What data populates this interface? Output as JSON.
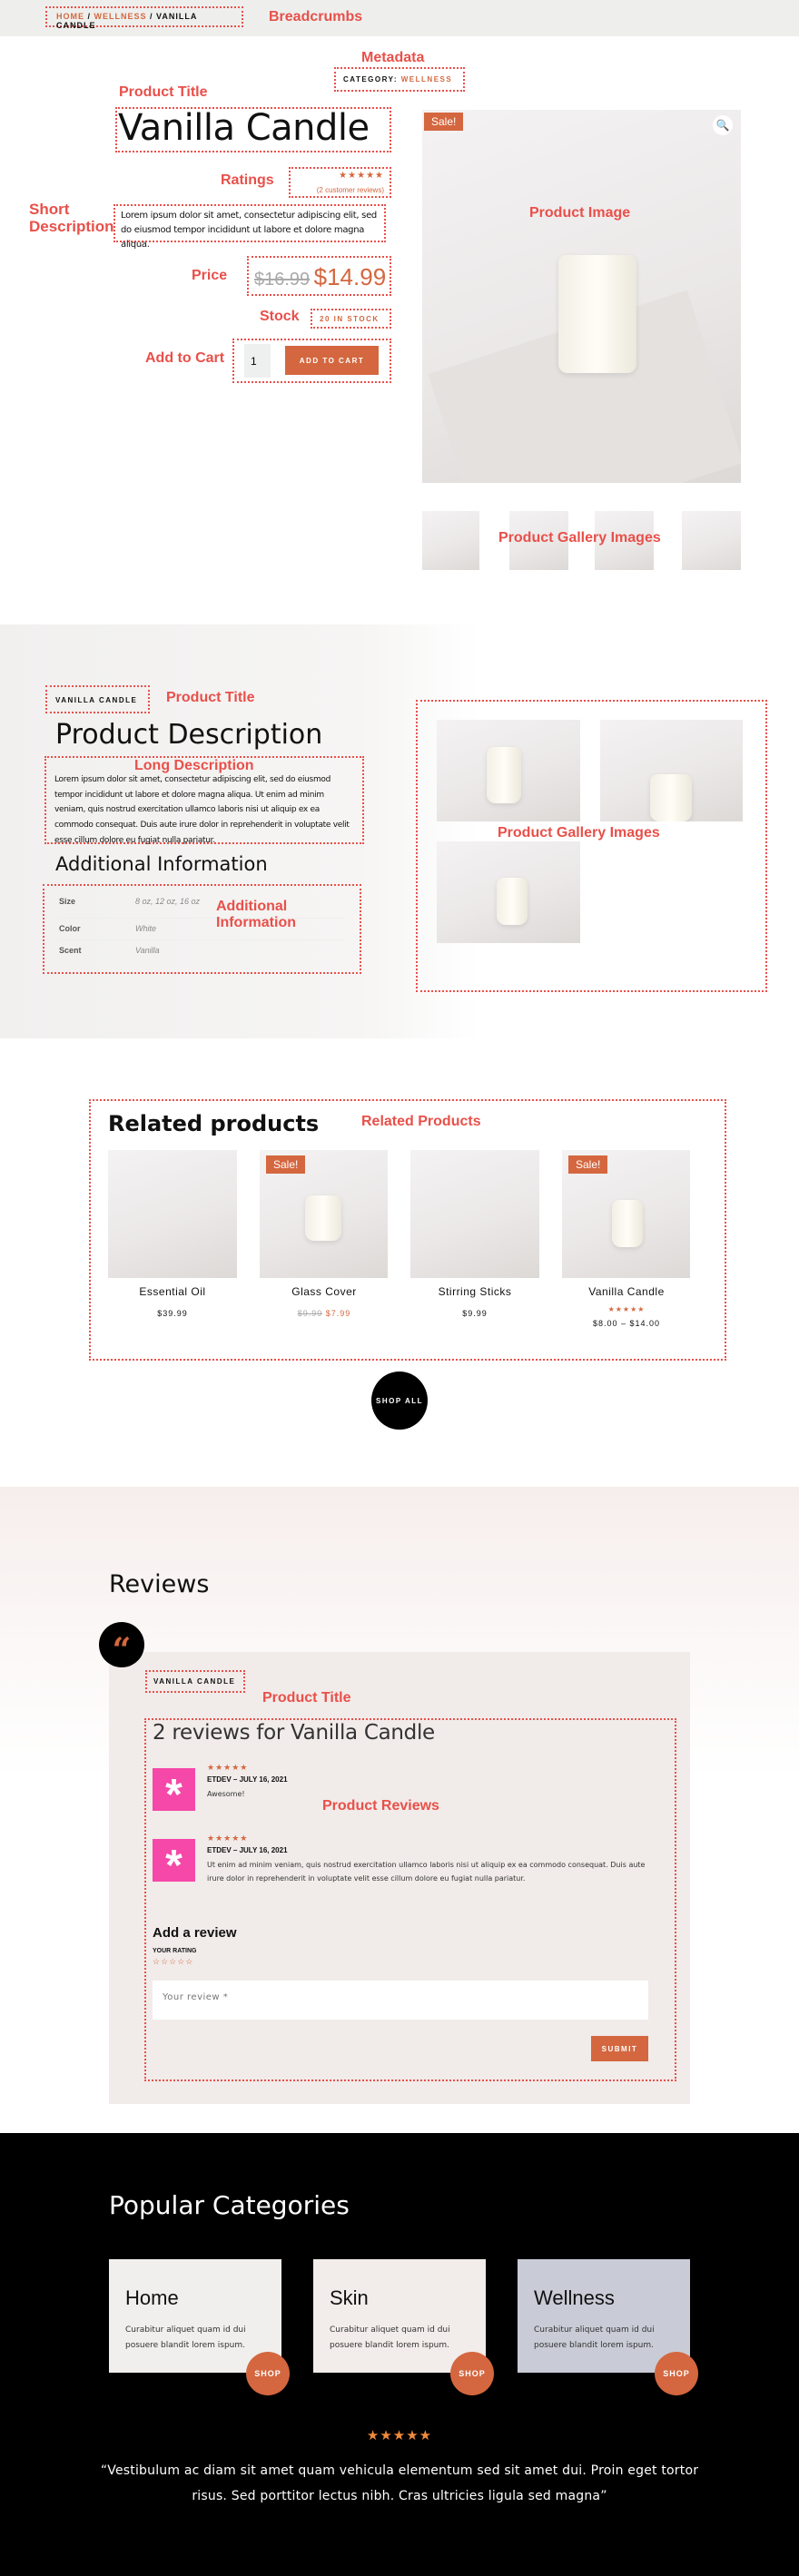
{
  "breadcrumbs": {
    "home": "Home",
    "sep1": " / ",
    "wellness": "Wellness",
    "sep2": " / ",
    "current": "Vanilla Candle"
  },
  "metadata": {
    "label": "Category:",
    "value": "Wellness"
  },
  "product": {
    "title": "Vanilla Candle",
    "stars": "★★★★★",
    "reviews_link": "(2 customer reviews)",
    "short_description": "Lorem ipsum dolor sit amet, consectetur adipiscing elit, sed do eiusmod tempor incididunt ut labore et dolore magna aliqua.",
    "old_price": "$16.99",
    "price": "$14.99",
    "stock": "20 in stock",
    "quantity": "1",
    "add_to_cart": "Add to cart",
    "sale_badge": "Sale!",
    "rating": 5
  },
  "description": {
    "title_tag": "Vanilla Candle",
    "heading": "Product Description",
    "text": "Lorem ipsum dolor sit amet, consectetur adipiscing elit, sed do eiusmod tempor incididunt ut labore et dolore magna aliqua. Ut enim ad minim veniam, quis nostrud exercitation ullamco laboris nisi ut aliquip ex ea commodo consequat. Duis aute irure dolor in reprehenderit in voluptate velit esse cillum dolore eu fugiat nulla pariatur.",
    "additional_heading": "Additional Information",
    "attributes": [
      {
        "name": "Size",
        "value": "8 oz, 12 oz, 16 oz"
      },
      {
        "name": "Color",
        "value": "White"
      },
      {
        "name": "Scent",
        "value": "Vanilla"
      }
    ]
  },
  "related": {
    "heading": "Related products",
    "products": [
      {
        "name": "Essential Oil",
        "price": "$39.99",
        "old_price": "",
        "sale": ""
      },
      {
        "name": "Glass Cover",
        "price": "$7.99",
        "old_price": "$9.99",
        "sale": "Sale!"
      },
      {
        "name": "Stirring Sticks",
        "price": "$9.99",
        "old_price": "",
        "sale": ""
      },
      {
        "name": "Vanilla Candle",
        "price": "$8.00 – $14.00",
        "old_price": "",
        "sale": "Sale!",
        "stars": "★★★★★"
      }
    ],
    "shop_all": "Shop All"
  },
  "reviews": {
    "heading": "Reviews",
    "title_tag": "Vanilla Candle",
    "count_heading": "2 reviews for Vanilla Candle",
    "items": [
      {
        "stars": "★★★★★",
        "author": "ETDEV",
        "date": "July 16, 2021",
        "text": "Awesome!"
      },
      {
        "stars": "★★★★★",
        "author": "ETDEV",
        "date": "July 16, 2021",
        "text": "Ut enim ad minim veniam, quis nostrud exercitation ullamco laboris nisi ut aliquip ex ea commodo consequat. Duis aute irure dolor in reprehenderit in voluptate velit esse cillum dolore eu fugiat nulla pariatur."
      }
    ],
    "add_heading": "Add a review",
    "rating_label": "Your rating",
    "empty_stars": "☆☆☆☆☆",
    "review_placeholder": "Your review *",
    "submit": "Submit"
  },
  "categories": {
    "heading": "Popular Categories",
    "items": [
      {
        "name": "Home",
        "text": "Curabitur aliquet quam id dui posuere blandit lorem ispum.",
        "button": "Shop"
      },
      {
        "name": "Skin",
        "text": "Curabitur aliquet quam id dui posuere blandit lorem ispum.",
        "button": "Shop"
      },
      {
        "name": "Wellness",
        "text": "Curabitur aliquet quam id dui posuere blandit lorem ispum.",
        "button": "Shop"
      }
    ],
    "testimonial_stars": "★★★★★",
    "testimonial": "“Vestibulum ac diam sit amet quam vehicula elementum sed sit amet dui. Proin eget tortor risus. Sed porttitor lectus nibh. Cras ultricies ligula sed magna”"
  },
  "annotations": {
    "breadcrumbs": "Breadcrumbs",
    "metadata": "Metadata",
    "product_title": "Product Title",
    "ratings": "Ratings",
    "short_description": "Short Description",
    "price": "Price",
    "stock": "Stock",
    "add_to_cart": "Add to Cart",
    "product_image": "Product Image",
    "gallery": "Product Gallery Images",
    "long_description": "Long Description",
    "additional_info": "Additional Information",
    "related": "Related Products",
    "reviews": "Product Reviews"
  },
  "colors": {
    "accent": "#d4673f",
    "annotation": "#e8504a",
    "avatar": "#f548a8",
    "footer_bg": "#000000"
  }
}
